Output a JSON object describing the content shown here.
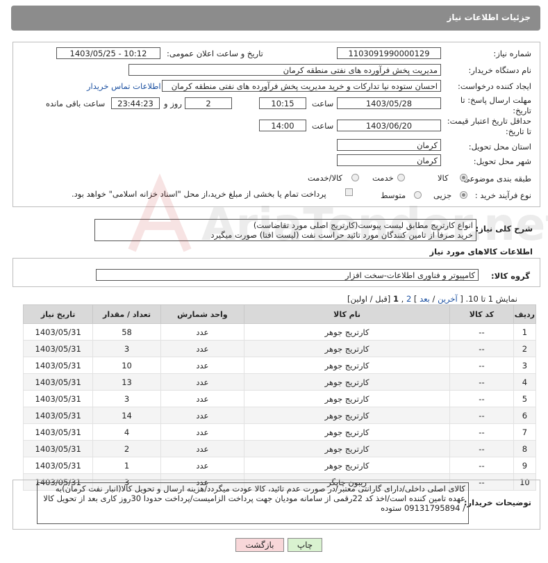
{
  "header": {
    "title": "جزئیات اطلاعات نیاز"
  },
  "form": {
    "need_number_label": "شماره نیاز:",
    "need_number": "1103091990000129",
    "announce_label": "تاریخ و ساعت اعلان عمومی:",
    "announce_value": "1403/05/25 - 10:12",
    "buyer_org_label": "نام دستگاه خریدار:",
    "buyer_org": "مدیریت پخش فرآورده های نفتی منطقه کرمان",
    "requester_label": "ایجاد کننده درخواست:",
    "requester": "احسان  ستوده نیا  تدارکات و خرید  مدیریت پخش فرآورده های نفتی منطقه کرمان",
    "contact_link": "اطلاعات تماس خریدار",
    "deadline_label": "مهلت ارسال پاسخ: تا تاریخ:",
    "deadline_date": "1403/05/28",
    "time_label": "ساعت",
    "deadline_time": "10:15",
    "days_value": "2",
    "days_label": "روز و",
    "remaining_value": "23:44:23",
    "remaining_label": "ساعت باقی مانده",
    "validity_label": "حداقل تاریخ اعتبار قیمت: تا تاریخ:",
    "validity_date": "1403/06/20",
    "validity_time": "14:00",
    "province_label": "استان محل تحویل:",
    "province": "کرمان",
    "city_label": "شهر محل تحویل:",
    "city": "کرمان",
    "category_label": "طبقه بندی موضوعی:",
    "category_options": [
      "کالا",
      "خدمت",
      "کالا/خدمت"
    ],
    "process_label": "نوع فرآیند خرید :",
    "process_options": [
      "جزیی",
      "متوسط"
    ],
    "payment_note": "پرداخت تمام یا بخشی از مبلغ خرید،از محل \"اسناد خزانه اسلامی\" خواهد بود."
  },
  "description": {
    "label": "شرح کلی نیاز:",
    "line1": "انواع کارتریج مطابق لیست پیوست(کارتریج اصلی مورد تقاضاست)",
    "line2": "خرید صرفاً از تامین کنندگان مورد تائید حراست نفت (لیست افتا) صورت میگیرد"
  },
  "goods_info": {
    "heading": "اطلاعات کالاهای مورد نیاز",
    "group_label": "گروه کالا:",
    "group_value": "کامپیوتر و فناوری اطلاعات-سخت افزار"
  },
  "pagination": {
    "shown": "نمایش 1 تا 10.",
    "open": "[",
    "last": "آخرین",
    "sep": "/",
    "next": "بعد",
    "close": "]",
    "page2": "2",
    "page1": "1",
    "comma": ",",
    "prev_first": "[قبل / اولین]"
  },
  "table": {
    "headers": [
      "ردیف",
      "کد کالا",
      "نام کالا",
      "واحد شمارش",
      "تعداد / مقدار",
      "تاریخ نیاز"
    ],
    "rows": [
      [
        "1",
        "--",
        "کارتریج جوهر",
        "عدد",
        "58",
        "1403/05/31"
      ],
      [
        "2",
        "--",
        "کارتریج جوهر",
        "عدد",
        "3",
        "1403/05/31"
      ],
      [
        "3",
        "--",
        "کارتریج جوهر",
        "عدد",
        "10",
        "1403/05/31"
      ],
      [
        "4",
        "--",
        "کارتریج جوهر",
        "عدد",
        "13",
        "1403/05/31"
      ],
      [
        "5",
        "--",
        "کارتریج جوهر",
        "عدد",
        "3",
        "1403/05/31"
      ],
      [
        "6",
        "--",
        "کارتریج جوهر",
        "عدد",
        "14",
        "1403/05/31"
      ],
      [
        "7",
        "--",
        "کارتریج جوهر",
        "عدد",
        "4",
        "1403/05/31"
      ],
      [
        "8",
        "--",
        "کارتریج جوهر",
        "عدد",
        "2",
        "1403/05/31"
      ],
      [
        "9",
        "--",
        "کارتریج جوهر",
        "عدد",
        "1",
        "1403/05/31"
      ],
      [
        "10",
        "--",
        "ریبون چاپگر",
        "عدد",
        "3",
        "1403/05/31"
      ]
    ]
  },
  "buyer_notes": {
    "label": "توضیحات خریدار:",
    "text": "کالای اصلی داخلی/دارای گارانتی معتبر/در صورت عدم تائید، کالا عودت میگردد/هزینه ارسال و تحویل کالا(انبار نفت کرمان)به عهده تامین کننده است/اخذ کد 22رقمی از سامانه مودیان جهت پرداخت الزامیست/پرداخت حدودا 30روز کاری بعد از تحویل کالا / 09131795894 ستوده"
  },
  "buttons": {
    "print": "چاپ",
    "back": "بازگشت"
  },
  "watermark": {
    "text": "AriaTender.net"
  },
  "colors": {
    "header_bg": "#8c8c8c",
    "back_bg": "#f8d7d9",
    "print_bg": "#d9f2d0",
    "link": "#1a4fa0"
  }
}
